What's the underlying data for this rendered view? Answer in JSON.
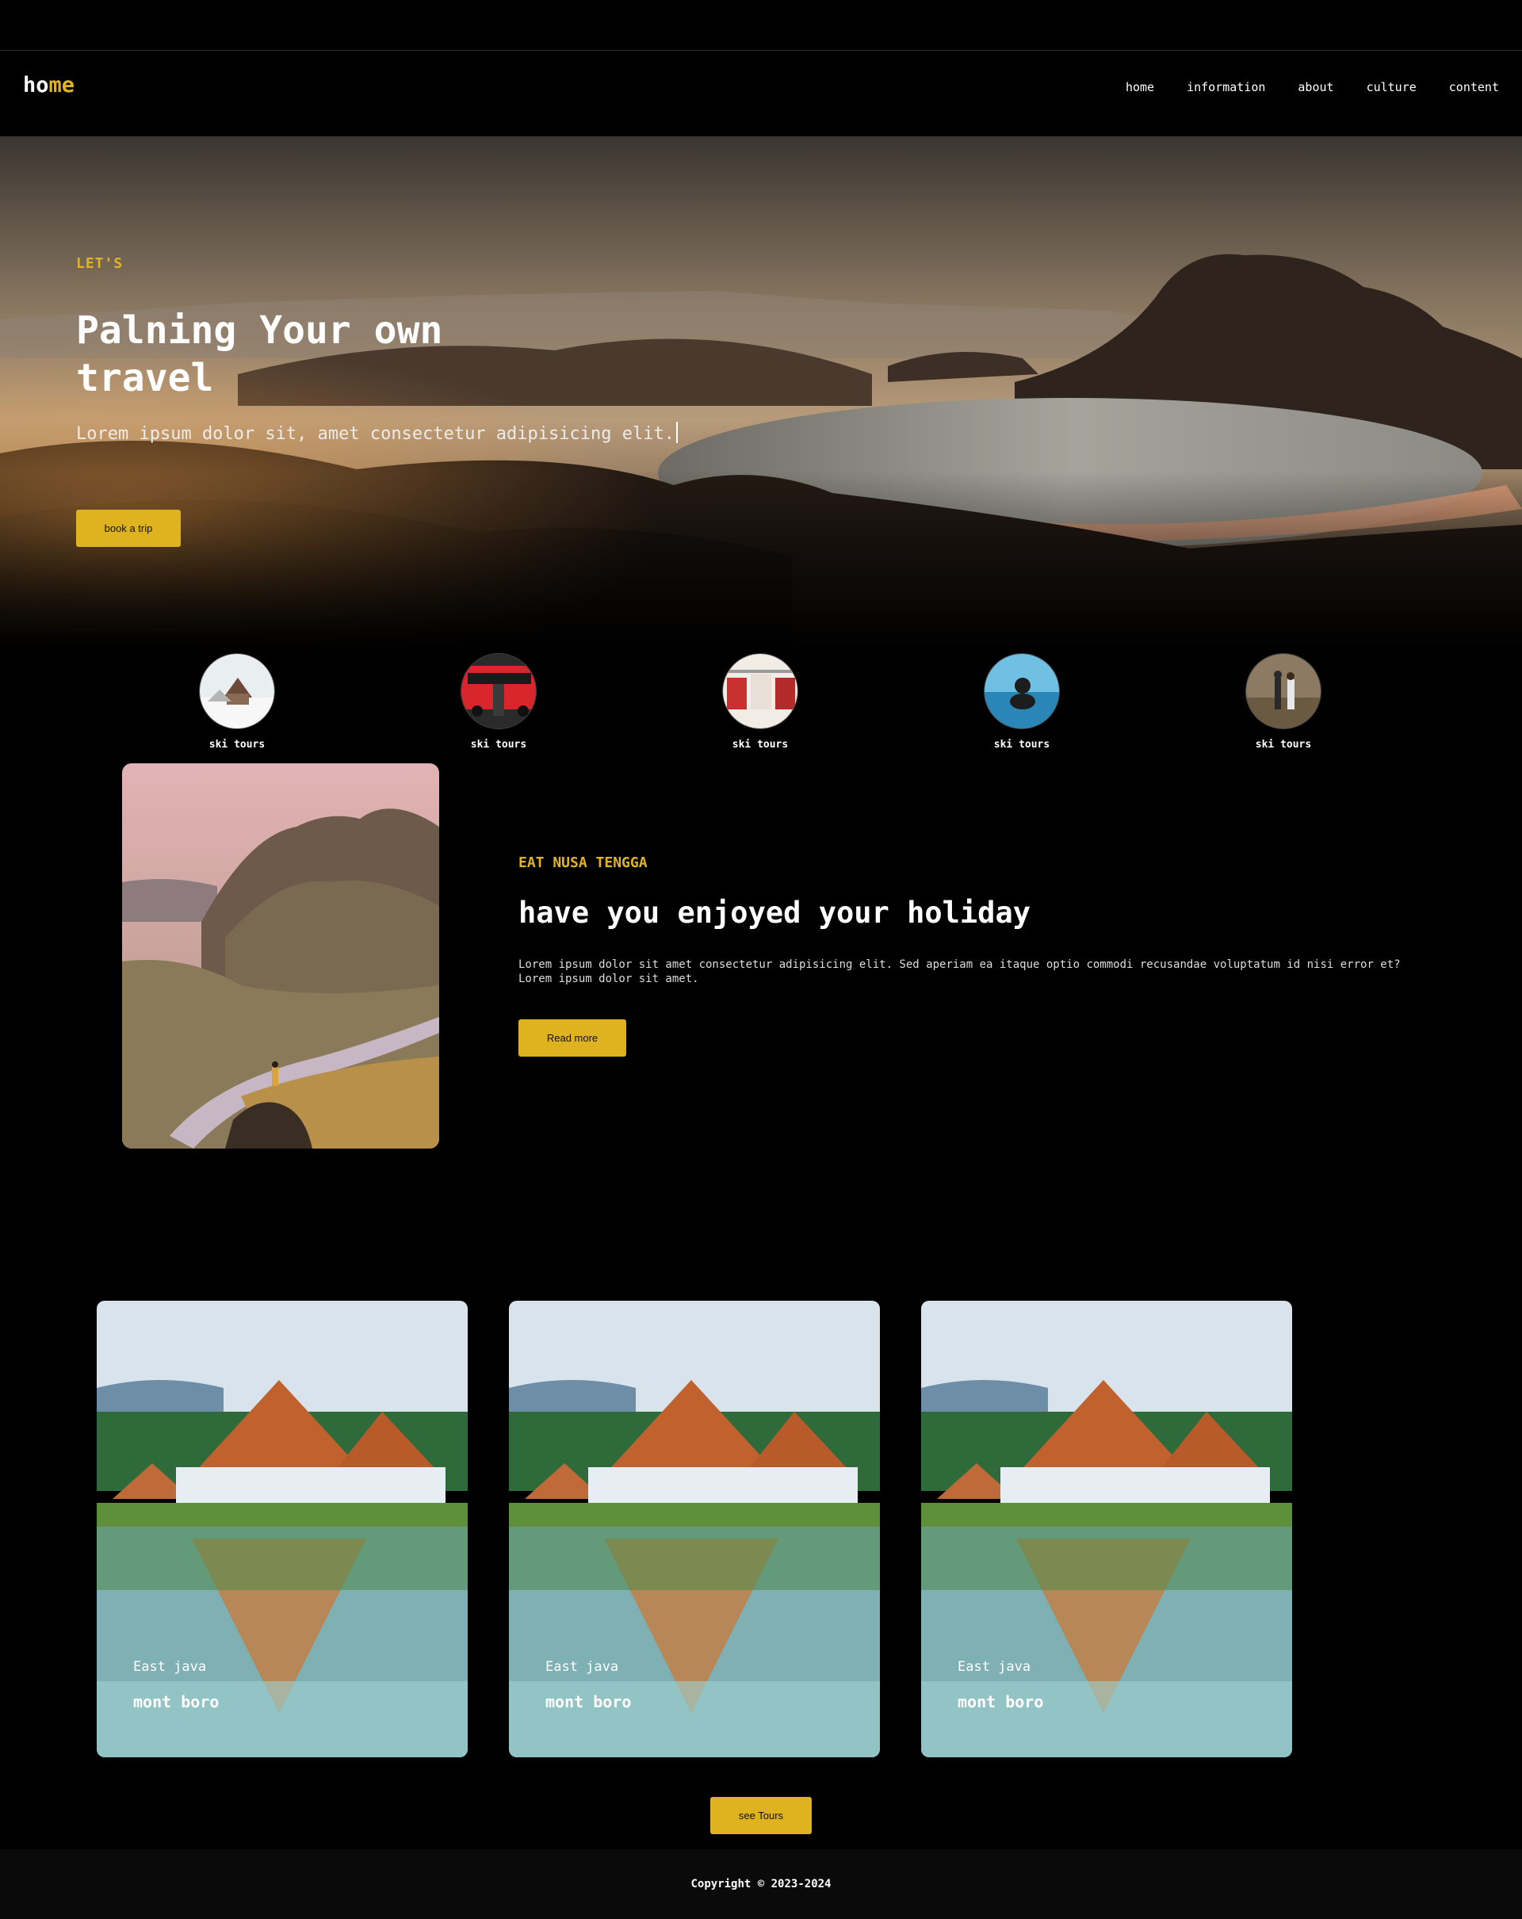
{
  "nav": {
    "logo_part1": "ho",
    "logo_part2": "me",
    "links": [
      "home",
      "information",
      "about",
      "culture",
      "content"
    ]
  },
  "hero": {
    "kicker": "LET'S",
    "title": "Palning Your own travel",
    "subtitle": "Lorem ipsum dolor sit, amet consectetur adipisicing elit.",
    "button": "book a trip"
  },
  "categories": [
    {
      "label": "ski tours",
      "icon": "snow-cabin-photo"
    },
    {
      "label": "ski tours",
      "icon": "red-bus-photo"
    },
    {
      "label": "ski tours",
      "icon": "clothing-store-photo"
    },
    {
      "label": "ski tours",
      "icon": "infinity-pool-photo"
    },
    {
      "label": "ski tours",
      "icon": "couple-walking-photo"
    }
  ],
  "feature": {
    "kicker": "EAT NUSA TENGGA",
    "title": "have you enjoyed your holiday",
    "text": "Lorem ipsum dolor sit amet consectetur adipisicing elit. Sed aperiam ea itaque optio commodi recusandae voluptatum id nisi error et? Lorem ipsum dolor sit amet.",
    "button": "Read more"
  },
  "cards": [
    {
      "region": "East java",
      "place": "mont boro"
    },
    {
      "region": "East java",
      "place": "mont boro"
    },
    {
      "region": "East java",
      "place": "mont boro"
    }
  ],
  "tours_button": "see Tours",
  "footer": "Copyright © 2023-2024",
  "colors": {
    "accent": "#dfb21f",
    "background": "#000000"
  }
}
